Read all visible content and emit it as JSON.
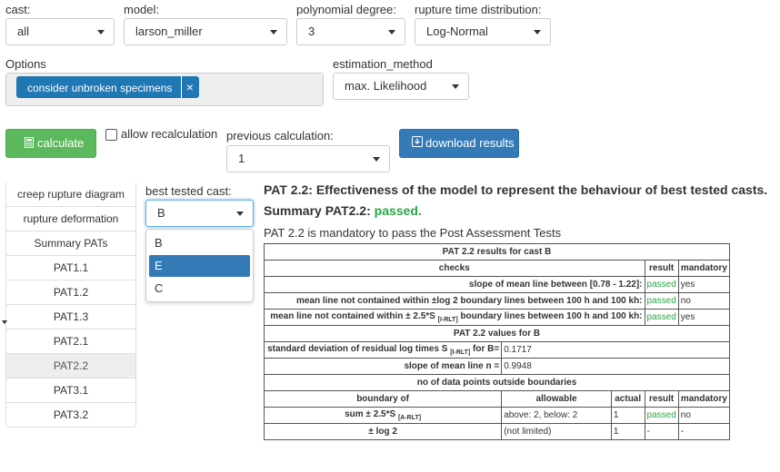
{
  "filters": {
    "cast_label": "cast:",
    "cast_value": "all",
    "model_label": "model:",
    "model_value": "larson_miller",
    "degree_label": "polynomial degree:",
    "degree_value": "3",
    "dist_label": "rupture time distribution:",
    "dist_value": "Log-Normal"
  },
  "options": {
    "label": "Options",
    "tag": "consider unbroken specimens",
    "tag_remove": "×",
    "estimation_label": "estimation_method",
    "estimation_value": "max. Likelihood"
  },
  "actions": {
    "calculate": "calculate",
    "allow_recalc": "allow recalculation",
    "prev_label": "previous calculation:",
    "prev_value": "1",
    "download": "download results"
  },
  "tabs": [
    "creep rupture diagram",
    "rupture deformation",
    "Summary PATs",
    "PAT1.1",
    "PAT1.2",
    "PAT1.3",
    "PAT2.1",
    "PAT2.2",
    "PAT3.1",
    "PAT3.2"
  ],
  "active_tab": "PAT2.2",
  "best_cast": {
    "label": "best tested cast:",
    "value": "B",
    "options": [
      "B",
      "E",
      "C"
    ],
    "highlighted": "E"
  },
  "report": {
    "heading": "PAT 2.2: Effectiveness of the model to represent the behaviour of best tested casts.",
    "summary_label": "Summary PAT2.2:",
    "summary_value": "passed.",
    "mandatory_note": "PAT 2.2 is mandatory to pass the Post Assessment Tests",
    "results_title": "PAT 2.2 results for cast B",
    "col_checks": "checks",
    "col_result": "result",
    "col_mandatory": "mandatory",
    "checks": [
      {
        "check": "slope of mean line between [0.78 - 1.22]:",
        "result": "passed",
        "mandatory": "yes"
      },
      {
        "check": "mean line not contained within ±log 2 boundary lines between 100 h and 100 kh:",
        "result": "passed",
        "mandatory": "no"
      },
      {
        "check_pre": "mean line not contained within ± 2.5*S",
        "check_sub": "[I-RLT]",
        "check_post": "boundary lines between 100 h and 100 kh:",
        "result": "passed",
        "mandatory": "yes"
      }
    ],
    "values_title": "PAT 2.2 values for B",
    "values": [
      {
        "pre": "standard deviation of residual log times S",
        "sub": "[I-RLT]",
        "post": "for B=",
        "value": "0.1717"
      },
      {
        "pre": "slope of mean line n =",
        "value": "0.9948"
      }
    ],
    "outside_title": "no of data points outside boundaries",
    "outside_cols": {
      "boundary": "boundary of",
      "allowable": "allowable",
      "actual": "actual",
      "result": "result",
      "mandatory": "mandatory"
    },
    "outside_rows": [
      {
        "pre": "sum ± 2.5*S",
        "sub": "[A-RLT]",
        "allowable": "above: 2, below: 2",
        "actual": "1",
        "result": "passed",
        "mandatory": "no"
      },
      {
        "pre": "± log 2",
        "allowable": "(not limited)",
        "actual": "1",
        "result": "-",
        "mandatory": "-"
      }
    ]
  },
  "colors": {
    "primary": "#337ab7",
    "success": "#5cb85c",
    "tag": "#1f77b4",
    "passed": "#28a745"
  }
}
